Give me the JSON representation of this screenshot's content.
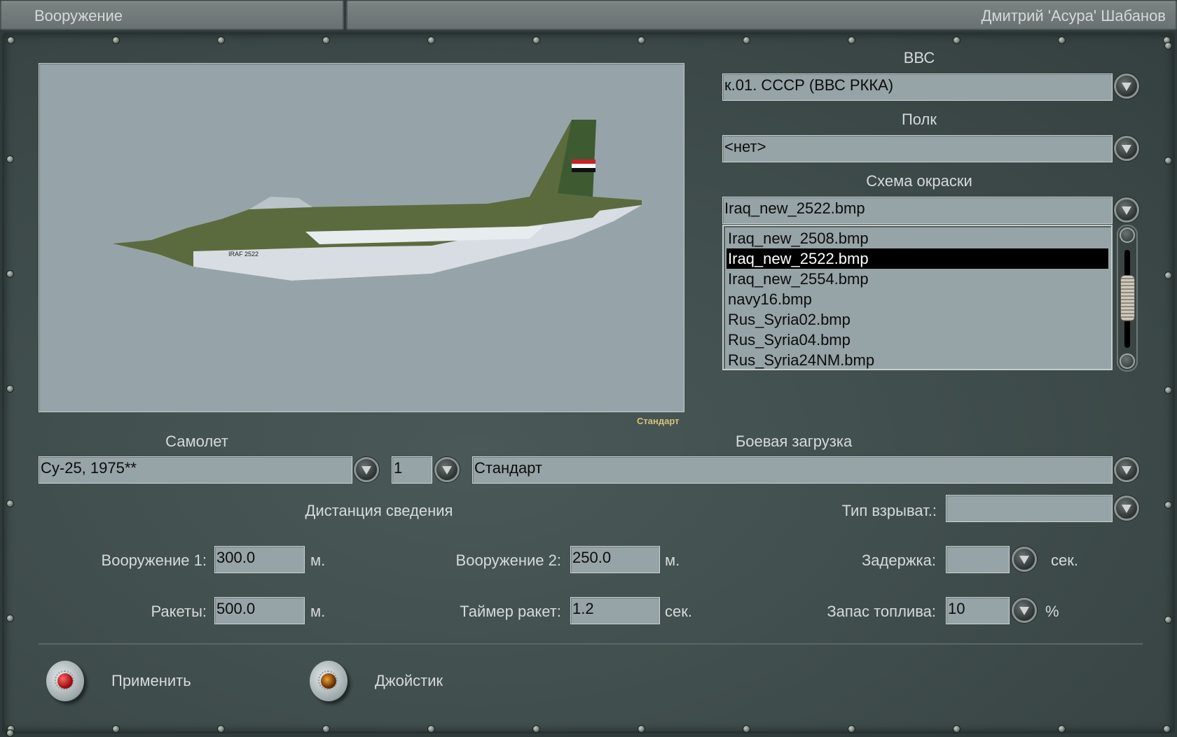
{
  "header": {
    "title": "Вооружение",
    "user": "Дмитрий 'Асура' Шабанов"
  },
  "preview": {
    "caption": "Стандарт",
    "tail_marking": "IRAF 2522"
  },
  "air_force": {
    "label": "ВВС",
    "value": "к.01. СССР (ВВС РККА)"
  },
  "regiment": {
    "label": "Полк",
    "value": "<нет>"
  },
  "skin": {
    "label": "Схема окраски",
    "value": "Iraq_new_2522.bmp",
    "options": [
      "Iraq_new_2508.bmp",
      "Iraq_new_2522.bmp",
      "Iraq_new_2554.bmp",
      "navy16.bmp",
      "Rus_Syria02.bmp",
      "Rus_Syria04.bmp",
      "Rus_Syria24NM.bmp"
    ],
    "selected_index": 1,
    "scroll_position": 0.5
  },
  "aircraft": {
    "label": "Самолет",
    "value": "Су-25, 1975**",
    "count": "1"
  },
  "loadout": {
    "label": "Боевая загрузка",
    "value": "Стандарт"
  },
  "convergence": {
    "label": "Дистанция сведения",
    "weapon1": {
      "label": "Вооружение 1:",
      "value": "300.0",
      "unit": "м."
    },
    "weapon2": {
      "label": "Вооружение 2:",
      "value": "250.0",
      "unit": "м."
    },
    "rockets": {
      "label": "Ракеты:",
      "value": "500.0",
      "unit": "м."
    },
    "rocket_timer": {
      "label": "Таймер ракет:",
      "value": "1.2",
      "unit": "сек."
    }
  },
  "fuze": {
    "label": "Тип взрыват.:",
    "value": ""
  },
  "delay": {
    "label": "Задержка:",
    "value": "",
    "unit": "сек."
  },
  "fuel": {
    "label": "Запас топлива:",
    "value": "10",
    "unit": "%"
  },
  "actions": {
    "apply": "Применить",
    "joystick": "Джойстик"
  }
}
